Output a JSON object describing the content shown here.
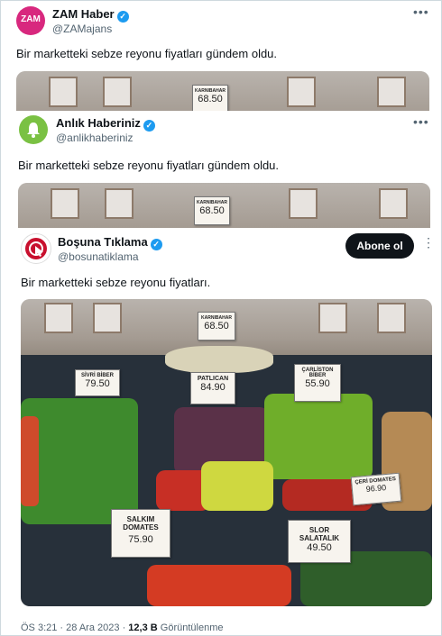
{
  "tweets": [
    {
      "name": "ZAM Haber",
      "handle": "@ZAMajans",
      "avatar_text": "ZAM",
      "text": "Bir marketteki sebze reyonu fiyatları gündem oldu.",
      "price_card": {
        "label": "KARNIBAHAR",
        "price": "68.50"
      }
    },
    {
      "name": "Anlık Haberiniz",
      "handle": "@anlikhaberiniz",
      "text": "Bir marketteki sebze reyonu fiyatları gündem oldu.",
      "price_card": {
        "label": "KARNIBAHAR",
        "price": "68.50"
      }
    },
    {
      "name": "Boşuna Tıklama",
      "handle": "@bosunatiklama",
      "follow_label": "Abone ol",
      "text": "Bir marketteki sebze reyonu fiyatları.",
      "price_cards": [
        {
          "label": "KARNIBAHAR",
          "price": "68.50"
        },
        {
          "label": "SİVRİ BİBER",
          "price": "79.50"
        },
        {
          "label": "PATLICAN",
          "price": "84.90"
        },
        {
          "label": "ÇARLİSTON BİBER",
          "price": "55.90"
        },
        {
          "label": "ÇERİ DOMATES",
          "price": "96.90"
        },
        {
          "label": "SALKIM DOMATES",
          "price": "75.90"
        },
        {
          "label": "SLOR SALATALIK",
          "price": "49.50"
        }
      ],
      "footer": {
        "time": "ÖS 3:21",
        "separator": "·",
        "date": "28 Ara 2023",
        "views_count": "12,3 B",
        "views_label": "Görüntülenme"
      }
    }
  ],
  "colors": {
    "verified": "#1d9bf0",
    "zam_avatar": "#d8287e",
    "anlik_avatar": "#7ac143",
    "bosuna_avatar": "#c8102e"
  },
  "icons": {
    "verified": "verified-badge-icon",
    "more": "more-options-icon",
    "bell": "bell-icon",
    "cursor": "cursor-click-icon"
  }
}
